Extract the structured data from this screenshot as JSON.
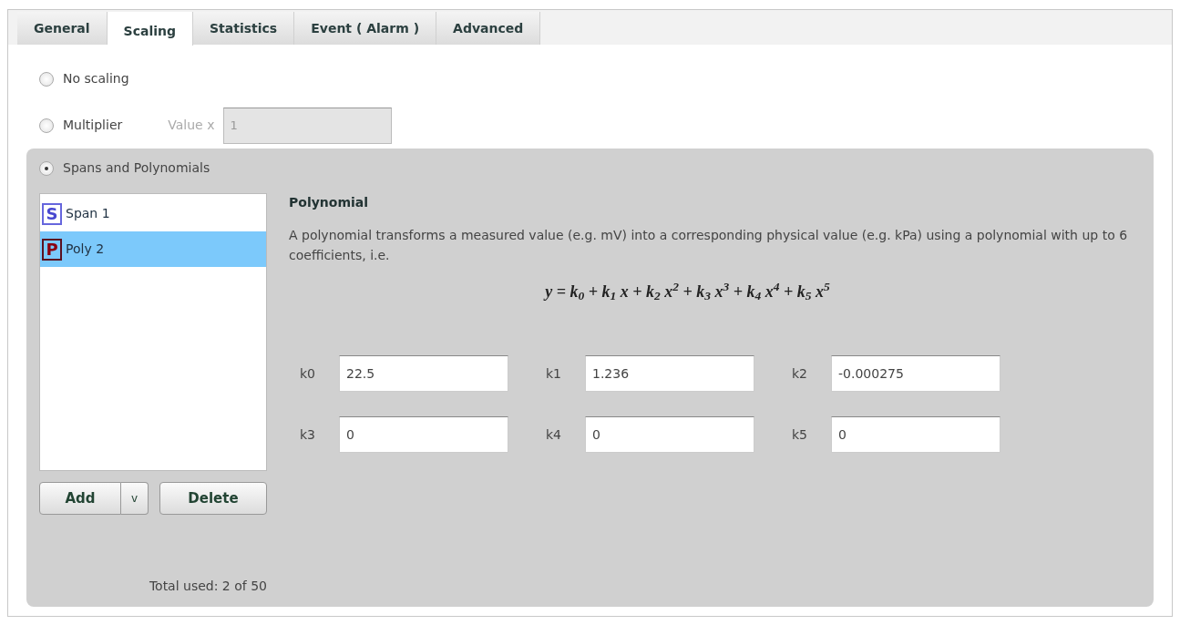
{
  "tabs": [
    {
      "label": "General",
      "selected": false
    },
    {
      "label": "Scaling",
      "selected": true
    },
    {
      "label": "Statistics",
      "selected": false
    },
    {
      "label": "Event ( Alarm )",
      "selected": false
    },
    {
      "label": "Advanced",
      "selected": false
    }
  ],
  "scaling_options": [
    {
      "label": "No scaling",
      "selected": false
    },
    {
      "label": "Multiplier",
      "selected": false,
      "field": {
        "label": "Value x",
        "value": "1",
        "disabled": true
      }
    },
    {
      "label": "Spans and Polynomials",
      "selected": true
    }
  ],
  "items": [
    {
      "kind": "span",
      "badge": "S",
      "label": "Span 1",
      "selected": false
    },
    {
      "kind": "poly",
      "badge": "P",
      "label": "Poly 2",
      "selected": true
    }
  ],
  "buttons": {
    "add": "Add",
    "add_menu": "v",
    "delete": "Delete"
  },
  "total_used": "Total used: 2 of 50",
  "detail": {
    "title": "Polynomial",
    "description": "A polynomial transforms a measured value (e.g. mV) into a corresponding physical value (e.g. kPa) using a polynomial with up to 6 coefficients, i.e.",
    "formula": "y = k$_{0}$ + k$_{1}$ x + k$_{2}$ x$^{2}$ + k$_{3}$ x$^{3}$ + k$_{4}$ x$^{4}$ + k$_{5}$ x$^{5}$",
    "coefficients": [
      {
        "label": "k0",
        "value": "22.5"
      },
      {
        "label": "k1",
        "value": "1.236"
      },
      {
        "label": "k2",
        "value": "-0.000275"
      },
      {
        "label": "k3",
        "value": "0"
      },
      {
        "label": "k4",
        "value": "0"
      },
      {
        "label": "k5",
        "value": "0"
      }
    ]
  }
}
